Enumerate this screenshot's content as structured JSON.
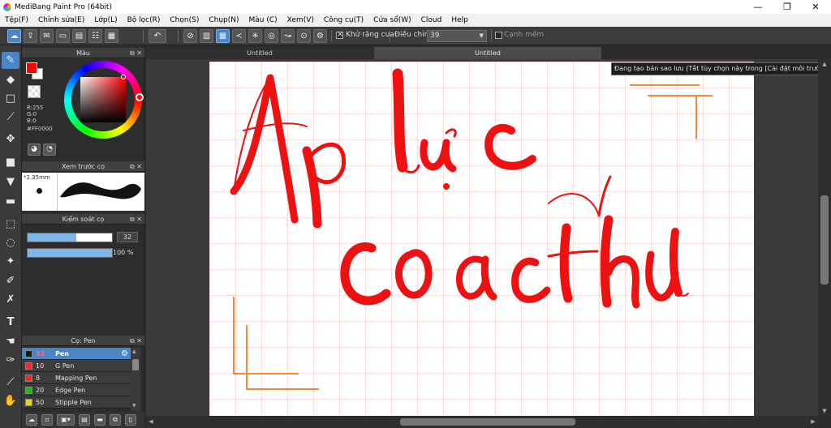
{
  "window": {
    "title": "MediBang Paint Pro (64bit)",
    "minimize": "—",
    "restore": "❐",
    "close": "✕"
  },
  "menu": [
    "Tệp(F)",
    "Chỉnh sửa(E)",
    "Lớp(L)",
    "Bộ lọc(R)",
    "Chọn(S)",
    "Chụp(N)",
    "Màu (C)",
    "Xem(V)",
    "Công cụ(T)",
    "Cửa sổ(W)",
    "Cloud",
    "Help"
  ],
  "toolbar": {
    "antialias_label": "Khử răng cưa",
    "adjust_label": "Điều chỉnh",
    "adjust_value": "39",
    "edge_label": "Cạnh mềm"
  },
  "color_panel": {
    "title": "Màu",
    "r": "R:255",
    "g": "G:0",
    "b": "B:0",
    "hex": "#FF0000",
    "foreground_color": "#ff0000"
  },
  "brush_preview_panel": {
    "title": "Xem trước cọ",
    "size": "2.35mm"
  },
  "brush_control_panel": {
    "title": "Kiểm soát cọ",
    "size_value": "32",
    "size_fraction": 0.58,
    "opacity_value": "100 %",
    "opacity_fraction": 1.0
  },
  "brush_panel": {
    "title": "Cọ: Pen",
    "brushes": [
      {
        "size": "32",
        "name": "Pen",
        "color": "#1a1a1a",
        "selected": true
      },
      {
        "size": "10",
        "name": "G Pen",
        "color": "#e53030",
        "selected": false
      },
      {
        "size": "8",
        "name": "Mapping Pen",
        "color": "#e53030",
        "selected": false
      },
      {
        "size": "20",
        "name": "Edge Pen",
        "color": "#29b023",
        "selected": false
      },
      {
        "size": "50",
        "name": "Stipple Pen",
        "color": "#e8d21a",
        "selected": false
      }
    ]
  },
  "tabs": [
    "Untitled",
    "Untitled"
  ],
  "tooltip": "Đang tạo bản sao lưu (Tắt tùy chọn này trong [Cài đặt môi trường])",
  "canvas": {
    "ink_color": "#ee1111",
    "guide_color": "#f08a3c"
  }
}
